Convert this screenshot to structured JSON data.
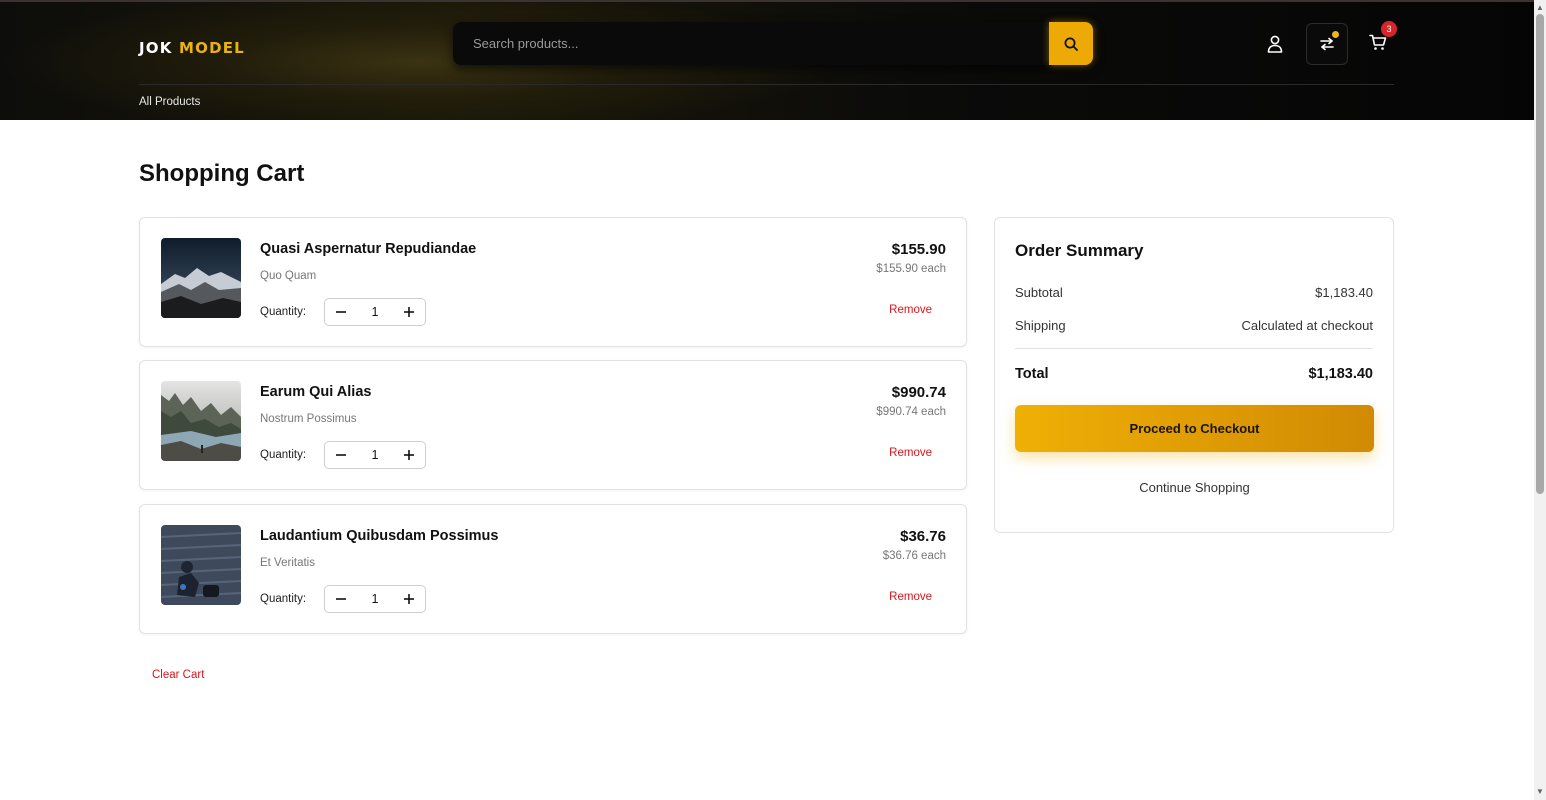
{
  "header": {
    "logo_part1": "JOK",
    "logo_part2": "MODEL",
    "search_placeholder": "Search products...",
    "nav_all_products": "All Products",
    "cart_count": "3",
    "accent_color": "#edaa07"
  },
  "page": {
    "title": "Shopping Cart"
  },
  "cart": {
    "quantity_label": "Quantity:",
    "remove_label": "Remove",
    "clear_cart_label": "Clear Cart",
    "items": [
      {
        "name": "Quasi Aspernatur Repudiandae",
        "category": "Quo Quam",
        "price": "$155.90",
        "each": "$155.90 each",
        "quantity": "1"
      },
      {
        "name": "Earum Qui Alias",
        "category": "Nostrum Possimus",
        "price": "$990.74",
        "each": "$990.74 each",
        "quantity": "1"
      },
      {
        "name": "Laudantium Quibusdam Possimus",
        "category": "Et Veritatis",
        "price": "$36.76",
        "each": "$36.76 each",
        "quantity": "1"
      }
    ]
  },
  "summary": {
    "title": "Order Summary",
    "subtotal_label": "Subtotal",
    "subtotal_value": "$1,183.40",
    "shipping_label": "Shipping",
    "shipping_value": "Calculated at checkout",
    "total_label": "Total",
    "total_value": "$1,183.40",
    "checkout_label": "Proceed to Checkout",
    "continue_label": "Continue Shopping"
  }
}
